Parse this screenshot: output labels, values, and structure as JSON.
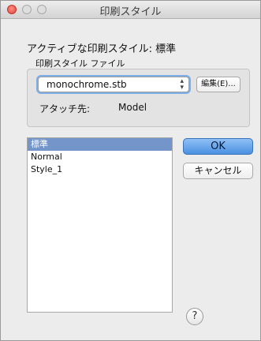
{
  "window": {
    "title": "印刷スタイル"
  },
  "header": {
    "active_style": "アクティブな印刷スタイル: 標準"
  },
  "file_group": {
    "label": "印刷スタイル ファイル",
    "selected_file": "monochrome.stb",
    "edit_label": "編集(E)...",
    "attach_label": "アタッチ先:",
    "attach_value": "Model"
  },
  "styles_list": {
    "items": [
      "標準",
      "Normal",
      "Style_1"
    ],
    "selected": "標準"
  },
  "buttons": {
    "ok": "OK",
    "cancel": "キャンセル",
    "help": "?"
  }
}
